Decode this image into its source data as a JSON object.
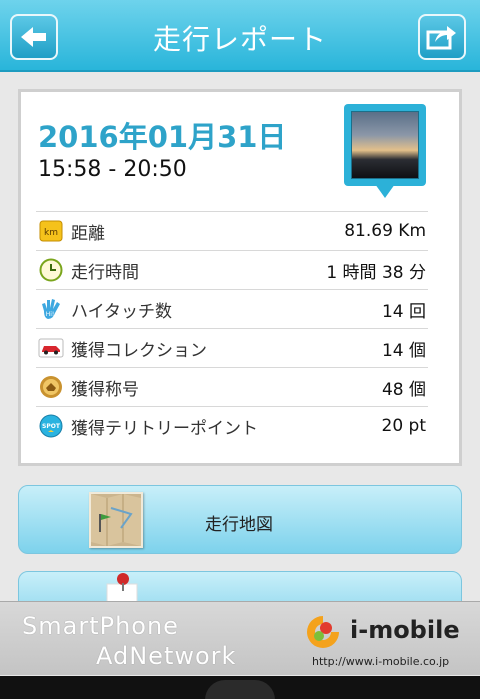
{
  "header": {
    "title": "走行レポート",
    "back_icon": "arrow-left-icon",
    "share_icon": "share-icon"
  },
  "report": {
    "date": "2016年01月31日",
    "time_range": "15:58 - 20:50",
    "rows": [
      {
        "icon": "km-icon",
        "label": "距離",
        "value": "81.69 Km"
      },
      {
        "icon": "clock-icon",
        "label": "走行時間",
        "value": "1 時間 38 分"
      },
      {
        "icon": "hi5-icon",
        "label": "ハイタッチ数",
        "value": "14 回"
      },
      {
        "icon": "car-icon",
        "label": "獲得コレクション",
        "value": "14 個"
      },
      {
        "icon": "medal-icon",
        "label": "獲得称号",
        "value": "48 個"
      },
      {
        "icon": "spot-icon",
        "label": "獲得テリトリーポイント",
        "value": "20 pt"
      }
    ]
  },
  "buttons": {
    "map_label": "走行地図"
  },
  "ad": {
    "line1": "SmartPhone",
    "line2": "AdNetwork",
    "brand": "i-mobile",
    "url": "http://www.i-mobile.co.jp"
  },
  "icon_text": {
    "km": "km",
    "hi5": "Hi!",
    "spot": "SPOT"
  },
  "colors": {
    "header": "#29b5da",
    "accent": "#2ea3c9"
  }
}
